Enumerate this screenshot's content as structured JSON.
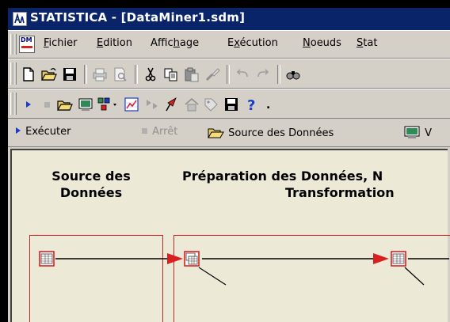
{
  "window": {
    "title": "STATISTICA - [DataMiner1.sdm]"
  },
  "menu": {
    "dm_icon_label": "DM",
    "items": [
      {
        "pre": "",
        "u": "F",
        "post": "ichier"
      },
      {
        "pre": "",
        "u": "E",
        "post": "dition"
      },
      {
        "pre": "Affic",
        "u": "h",
        "post": "age"
      },
      {
        "pre": "E",
        "u": "x",
        "post": "écution"
      },
      {
        "pre": "",
        "u": "N",
        "post": "oeuds"
      },
      {
        "pre": "",
        "u": "S",
        "post": "tat"
      }
    ]
  },
  "standard_toolbar": {
    "icons": [
      "new-icon",
      "open-icon",
      "save-icon",
      "print-icon",
      "print-preview-icon",
      "cut-icon",
      "copy-icon",
      "paste-icon",
      "format-painter-icon",
      "undo-icon",
      "redo-icon",
      "find-icon"
    ]
  },
  "dm_toolbar": {
    "icons": [
      "run-icon",
      "stop-icon",
      "open-icon",
      "data-source-icon",
      "node-browser-icon",
      "graph-icon",
      "workspace-icon",
      "arrow-icon",
      "home-icon",
      "tag-icon",
      "save-icon",
      "help-icon"
    ],
    "overflow": "."
  },
  "exec_toolbar": {
    "run_label": "Exécuter",
    "stop_label": "Arrêt",
    "source_label": "Source des Données",
    "next_label": "V"
  },
  "workspace": {
    "col1_line1": "Source des",
    "col1_line2": "Données",
    "col2_line1": "Préparation des Données, N",
    "col2_line2": "Transformation"
  },
  "colors": {
    "title_bg": "#0a246a",
    "canvas_bg": "#ecead7",
    "node_border": "#d82020"
  }
}
